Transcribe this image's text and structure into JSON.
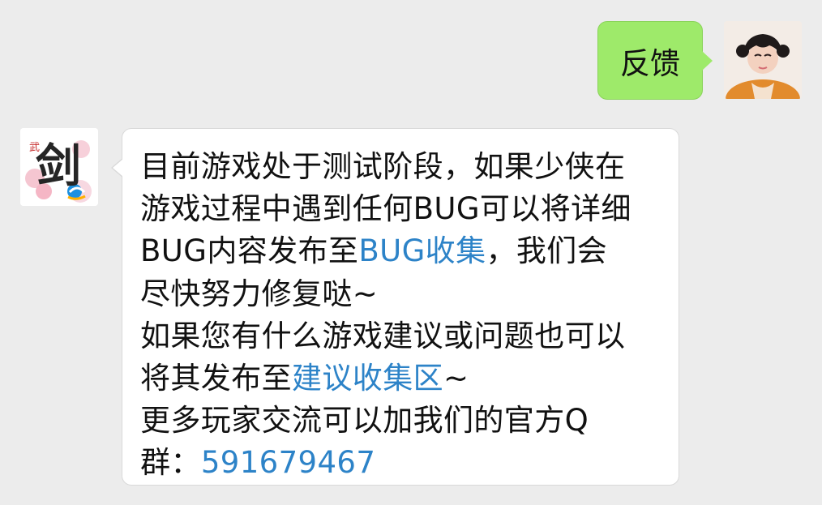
{
  "chat": {
    "sent_message": "反馈",
    "reply_lines": [
      {
        "before": "目前游戏处于测试阶段，如果少侠在"
      },
      {
        "before": "游戏过程中遇到任何BUG可以将详细"
      },
      {
        "before": "BUG内容发布至",
        "link": "BUG收集",
        "after": "，我们会"
      },
      {
        "before": "尽快努力修复哒~"
      },
      {
        "before": "如果您有什么游戏建议或问题也可以"
      },
      {
        "before": "将其发布至",
        "link": "建议收集区",
        "after": "~"
      },
      {
        "before": "更多玩家交流可以加我们的官方Q"
      },
      {
        "before": "群：",
        "link": "591679467"
      }
    ]
  },
  "bot_avatar": {
    "icon": "game-logo-jian-icon",
    "logo_text": "剑",
    "corner_text": "武"
  },
  "user_avatar": {
    "icon": "user-avatar-portrait"
  },
  "colors": {
    "background": "#ececec",
    "sent_bubble": "#9eea6a",
    "received_bubble": "#ffffff",
    "link": "#2d83c8",
    "text": "#111111"
  }
}
